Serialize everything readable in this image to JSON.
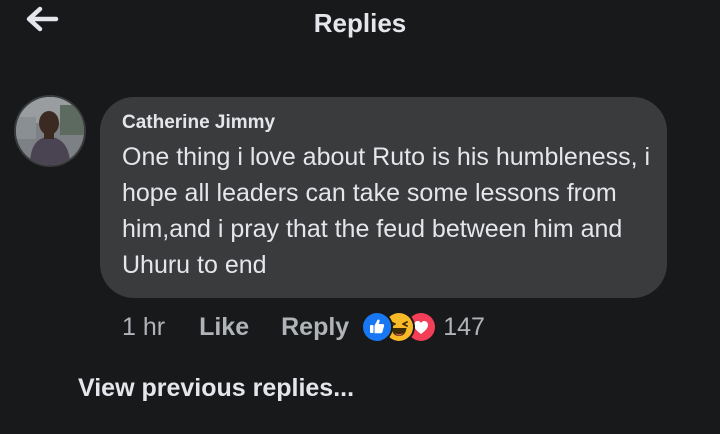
{
  "header": {
    "title": "Replies",
    "back_icon": "arrow-left-icon"
  },
  "comment": {
    "author": "Catherine Jimmy",
    "text": "One thing i love about Ruto is his humbleness, i hope all leaders can take some lessons from him,and i pray that the feud between him and Uhuru to end",
    "time": "1 hr",
    "like_label": "Like",
    "reply_label": "Reply",
    "reactions": [
      "like-reaction-icon",
      "haha-reaction-icon",
      "love-reaction-icon"
    ],
    "reaction_count": "147"
  },
  "footer": {
    "view_previous_label": "View previous replies..."
  },
  "colors": {
    "background": "#18191a",
    "bubble": "#3a3b3c",
    "primary_text": "#e4e6eb",
    "secondary_text": "#b0b3b8",
    "like_blue": "#1877f2",
    "love_red": "#f33e58",
    "haha_yellow": "#f7b928"
  }
}
